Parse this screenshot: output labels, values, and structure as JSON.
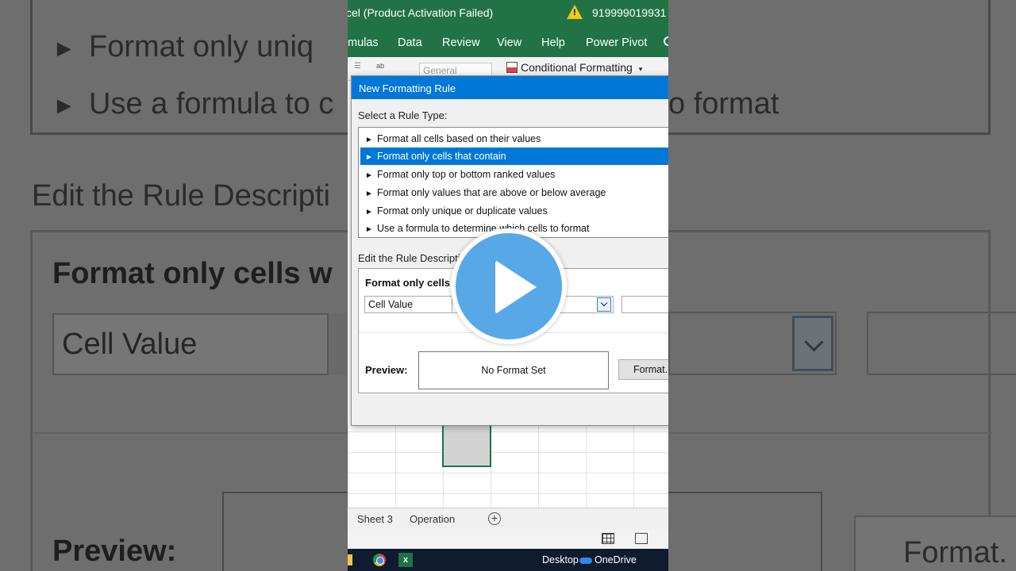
{
  "window": {
    "title": "cel (Product Activation Failed)",
    "phone": "919999019931"
  },
  "ribbon_tabs": [
    "mulas",
    "Data",
    "Review",
    "View",
    "Help",
    "Power Pivot"
  ],
  "ribbon": {
    "wrap_text_glyph": "ab",
    "number_format": "General",
    "conditional_formatting": "Conditional Formatting"
  },
  "dialog": {
    "title": "New Formatting Rule",
    "select_label": "Select a Rule Type:",
    "rule_types": [
      "Format all cells based on their values",
      "Format only cells that contain",
      "Format only top or bottom ranked values",
      "Format only values that are above or below average",
      "Format only unique or duplicate values",
      "Use a formula to determine which cells to format"
    ],
    "selected_index": 1,
    "edit_label": "Edit the Rule Descripti",
    "desc_header": "Format only cells",
    "cell_value": "Cell Value",
    "preview_label": "Preview:",
    "preview_text": "No Format Set",
    "format_button": "Format..."
  },
  "sheets": [
    "Sheet 3",
    "Operation"
  ],
  "add_sheet": "+",
  "taskbar": {
    "excel_letter": "x",
    "desktop": "Desktop",
    "onedrive": "OneDrive"
  },
  "background": {
    "line1": "Format only uniq",
    "line2": "Use a formula to c",
    "line2_tail": "o format",
    "edit_label": "Edit the Rule Descripti",
    "header": "Format only cells w",
    "cell_value": "Cell Value",
    "preview_label": "Preview:",
    "format_button": "Format."
  },
  "colors": {
    "excel_green": "#217346",
    "selection_blue": "#0078d7",
    "play_blue": "#58a8e8"
  }
}
